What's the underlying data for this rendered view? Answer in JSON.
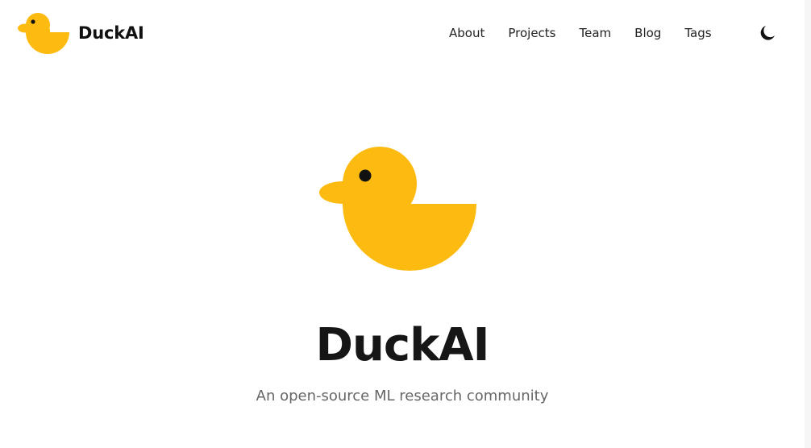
{
  "header": {
    "brand_name": "DuckAI",
    "nav": [
      {
        "label": "About"
      },
      {
        "label": "Projects"
      },
      {
        "label": "Team"
      },
      {
        "label": "Blog"
      },
      {
        "label": "Tags"
      }
    ],
    "theme_toggle_icon": "moon-icon"
  },
  "hero": {
    "logo_icon": "duck-logo-icon",
    "title": "DuckAI",
    "subtitle": "An open-source ML research community"
  },
  "colors": {
    "duck_yellow": "#FDBB11",
    "eye_black": "#111111",
    "text_dark": "#161616",
    "text_muted": "#666666",
    "background": "#FFFFFF"
  }
}
